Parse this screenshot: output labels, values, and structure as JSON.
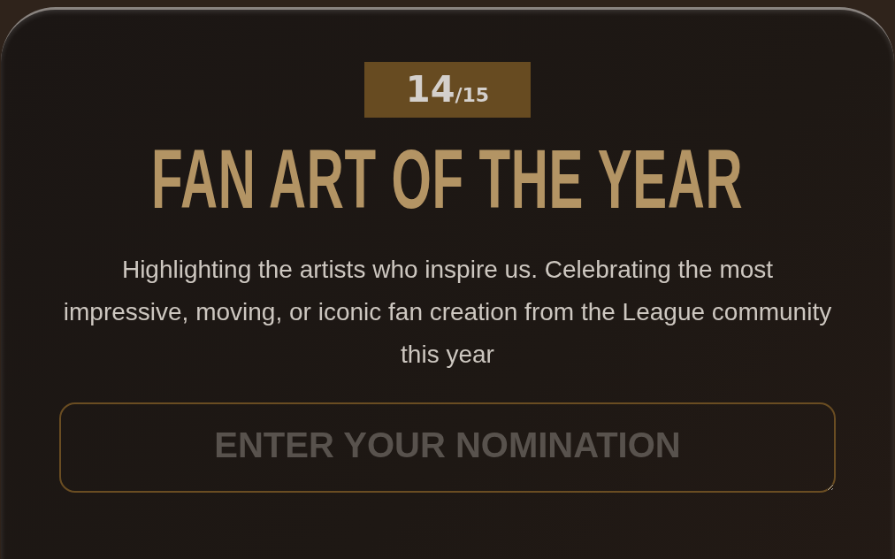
{
  "badge": {
    "count": "14",
    "total": "/15"
  },
  "title": "FAN ART OF THE YEAR",
  "description": "Highlighting the artists who inspire us. Celebrating the most impressive, moving, or iconic fan creation from the League community this year",
  "nomination": {
    "placeholder": "ENTER YOUR NOMINATION"
  }
}
